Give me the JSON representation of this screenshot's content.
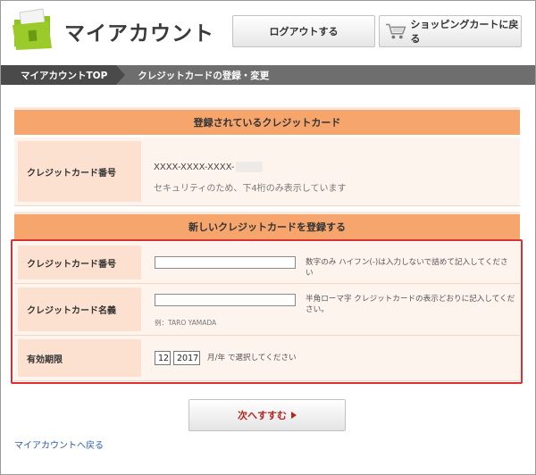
{
  "header": {
    "title": "マイアカウント",
    "logout_label": "ログアウトする",
    "cart_label": "ショッピングカートに戻る"
  },
  "breadcrumb": {
    "home": "マイアカウントTOP",
    "current": "クレジットカードの登録・変更"
  },
  "registered": {
    "heading": "登録されているクレジットカード",
    "label": "クレジットカード番号",
    "masked_number": "XXXX-XXXX-XXXX-",
    "note": "セキュリティのため、下4桁のみ表示しています"
  },
  "new_card": {
    "heading": "新しいクレジットカードを登録する",
    "number": {
      "label": "クレジットカード番号",
      "value": "",
      "hint": "数字のみ ハイフン(-)は入力しないで詰めて記入してください"
    },
    "name": {
      "label": "クレジットカード名義",
      "value": "",
      "hint": "半角ローマ字 クレジットカードの表示どおりに記入してください。",
      "example": "例：TARO YAMADA"
    },
    "expiry": {
      "label": "有効期限",
      "month": "12",
      "year": "2017",
      "hint": "月/年 で選択してください"
    }
  },
  "actions": {
    "next_label": "次へすすむ",
    "back_link": "マイアカウントへ戻る"
  },
  "colors": {
    "section_bar": "#f6a66c",
    "row_bg": "#fef4ee",
    "label_bg": "#fce0d0",
    "highlight_frame": "#dd2f2f",
    "link": "#2a5caa"
  }
}
